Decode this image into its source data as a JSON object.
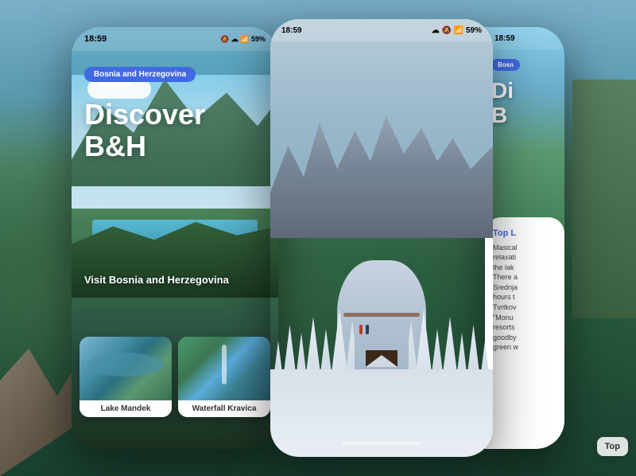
{
  "background": {
    "description": "Mountain landscape background"
  },
  "phone1": {
    "statusBar": {
      "time": "18:59",
      "icons": "🔕 ☁ 📶 59%"
    },
    "badge": "Bosnia and Herzegovina",
    "title": "Discover\nB&H",
    "subtitle": "Visit Bosnia and Herzegovina",
    "cards": [
      {
        "label": "Lake Mandek",
        "type": "lake"
      },
      {
        "label": "Waterfall Kravica",
        "type": "waterfall"
      }
    ]
  },
  "phone2": {
    "statusBar": {
      "time": "18:59",
      "icons": "☁ 🔕 📶 59%"
    },
    "scene": "Winter snowy mountain with cabin and frozen lake",
    "homeIndicator": "—"
  },
  "phone3": {
    "statusBar": {
      "time": "18:59"
    },
    "badge": "Bosn",
    "title": "Di\nB",
    "card": {
      "title": "Top L",
      "text": "Masical\nrelaxati\nthe lak\nThere a\nSrednja\nhours t\nTvrtkow\n\"Monu\nresorts\ngoodby\ngreen w"
    }
  },
  "topButton": {
    "label": "Top"
  }
}
